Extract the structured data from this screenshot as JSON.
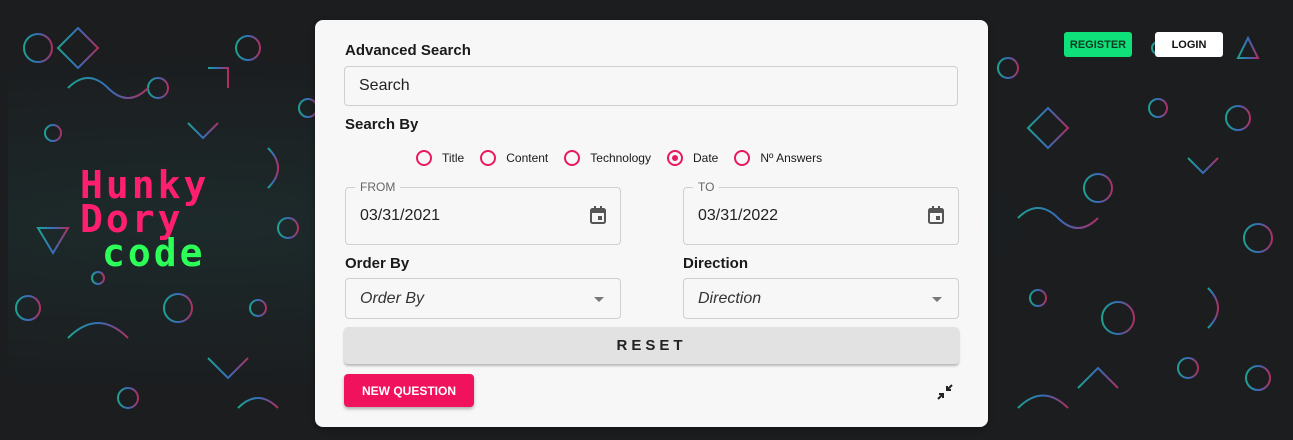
{
  "header": {
    "register_label": "REGISTER",
    "login_label": "LOGIN"
  },
  "logo": {
    "line1": "Hunky",
    "line2": "Dory",
    "line3": "code"
  },
  "advanced_search": {
    "title": "Advanced Search",
    "search_placeholder": "Search",
    "search_by_label": "Search By",
    "search_by_options": [
      {
        "label": "Title",
        "selected": false
      },
      {
        "label": "Content",
        "selected": false
      },
      {
        "label": "Technology",
        "selected": false
      },
      {
        "label": "Date",
        "selected": true
      },
      {
        "label": "Nº Answers",
        "selected": false
      }
    ],
    "from": {
      "legend": "FROM",
      "value": "03/31/2021"
    },
    "to": {
      "legend": "TO",
      "value": "03/31/2022"
    },
    "order_by_label": "Order By",
    "order_by_placeholder": "Order By",
    "direction_label": "Direction",
    "direction_placeholder": "Direction",
    "reset_label": "RESET",
    "new_question_label": "NEW QUESTION"
  },
  "colors": {
    "accent": "#e8195d",
    "new_question": "#f0125c",
    "register": "#10e07a",
    "logo_pink": "#ff1f6e",
    "logo_green": "#2cff58"
  },
  "icons": [
    "calendar-icon",
    "collapse-icon",
    "dropdown-arrow-icon"
  ]
}
